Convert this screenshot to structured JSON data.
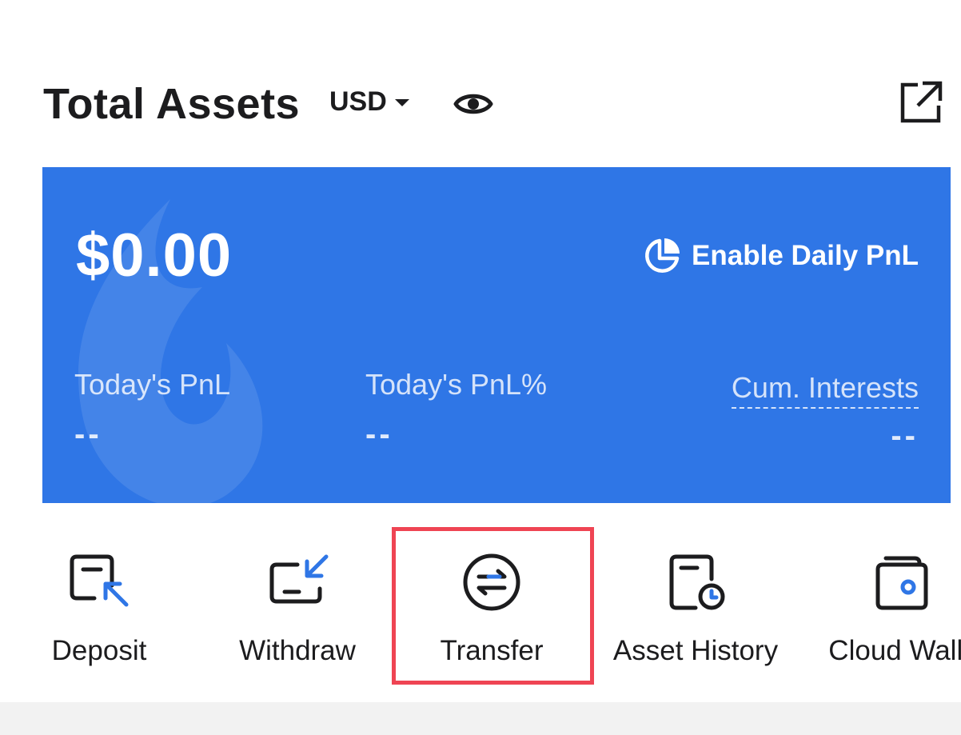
{
  "header": {
    "title": "Total Assets",
    "currency": "USD",
    "visibility_icon": "eye-icon",
    "share_icon": "external-link-icon"
  },
  "card": {
    "balance": "$0.00",
    "pnl_toggle_label": "Enable Daily PnL",
    "pnl_toggle_icon": "pie-chart-icon",
    "stats": [
      {
        "label": "Today's PnL",
        "value": "--"
      },
      {
        "label": "Today's PnL%",
        "value": "--"
      },
      {
        "label": "Cum. Interests",
        "value": "--"
      }
    ],
    "background_color": "#2f76e6"
  },
  "actions": [
    {
      "label": "Deposit",
      "icon": "deposit-icon"
    },
    {
      "label": "Withdraw",
      "icon": "withdraw-icon"
    },
    {
      "label": "Transfer",
      "icon": "transfer-icon",
      "highlighted": true
    },
    {
      "label": "Asset History",
      "icon": "asset-history-icon"
    },
    {
      "label": "Cloud Walle",
      "icon": "cloud-wallet-icon"
    }
  ],
  "colors": {
    "accent_blue": "#2f76e6",
    "highlight_red": "#ef4453",
    "text_dark": "#1c1c1e"
  }
}
